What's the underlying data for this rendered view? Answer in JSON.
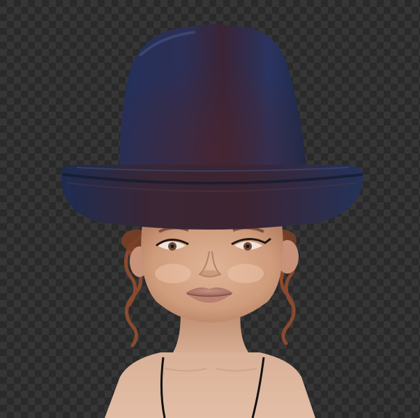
{
  "canvas": {
    "background": "transparency-checkerboard",
    "checker_colors": [
      "#2a2a2a",
      "#363636"
    ]
  },
  "subject": {
    "description_kind": "3d-avatar-render",
    "hat": {
      "type": "bowler-style-high-crown-hat",
      "color": "#26304f",
      "shade_color": "#3a2230",
      "highlight_color": "#3b4a72"
    },
    "skin_color": "#d4a383",
    "lip_color": "#b0776a",
    "hair_color": "#8a4a2e",
    "top_strap_color": "#111111"
  }
}
